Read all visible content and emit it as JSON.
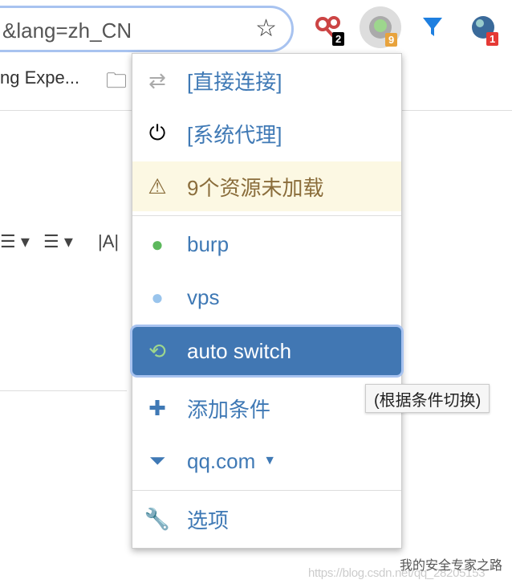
{
  "address_bar": {
    "value": "&lang=zh_CN"
  },
  "extensions": [
    {
      "name": "scissors-extension",
      "badge": "2",
      "badge_color": "#000000"
    },
    {
      "name": "proxy-switchyomega",
      "badge": "9",
      "badge_color": "#e8a33d"
    },
    {
      "name": "filter-extension"
    },
    {
      "name": "globe-extension",
      "badge": "1",
      "badge_color": "#e53935"
    }
  ],
  "bookmarks": {
    "item": "ng Expe..."
  },
  "toolbar": {
    "text_icon": "|A|"
  },
  "menu": {
    "items": [
      {
        "label": "[直接连接]",
        "icon": "direct-connect-icon"
      },
      {
        "label": "[系统代理]",
        "icon": "power-icon"
      },
      {
        "label": "9个资源未加载",
        "icon": "warning-icon"
      },
      {
        "label": "burp",
        "icon": "globe-icon"
      },
      {
        "label": "vps",
        "icon": "globe-icon"
      },
      {
        "label": "auto switch",
        "icon": "auto-switch-icon",
        "active": true
      },
      {
        "label": "添加条件",
        "icon": "plus-icon"
      },
      {
        "label": "qq.com",
        "icon": "filter-icon"
      },
      {
        "label": "选项",
        "icon": "wrench-icon"
      }
    ]
  },
  "tooltip": "(根据条件切换)",
  "watermark": {
    "account": "我的安全专家之路",
    "url": "https://blog.csdn.net/qq_28205153"
  },
  "colors": {
    "accent": "#4177b3",
    "link": "#3f79b5",
    "warning_bg": "#fcf8e3"
  }
}
